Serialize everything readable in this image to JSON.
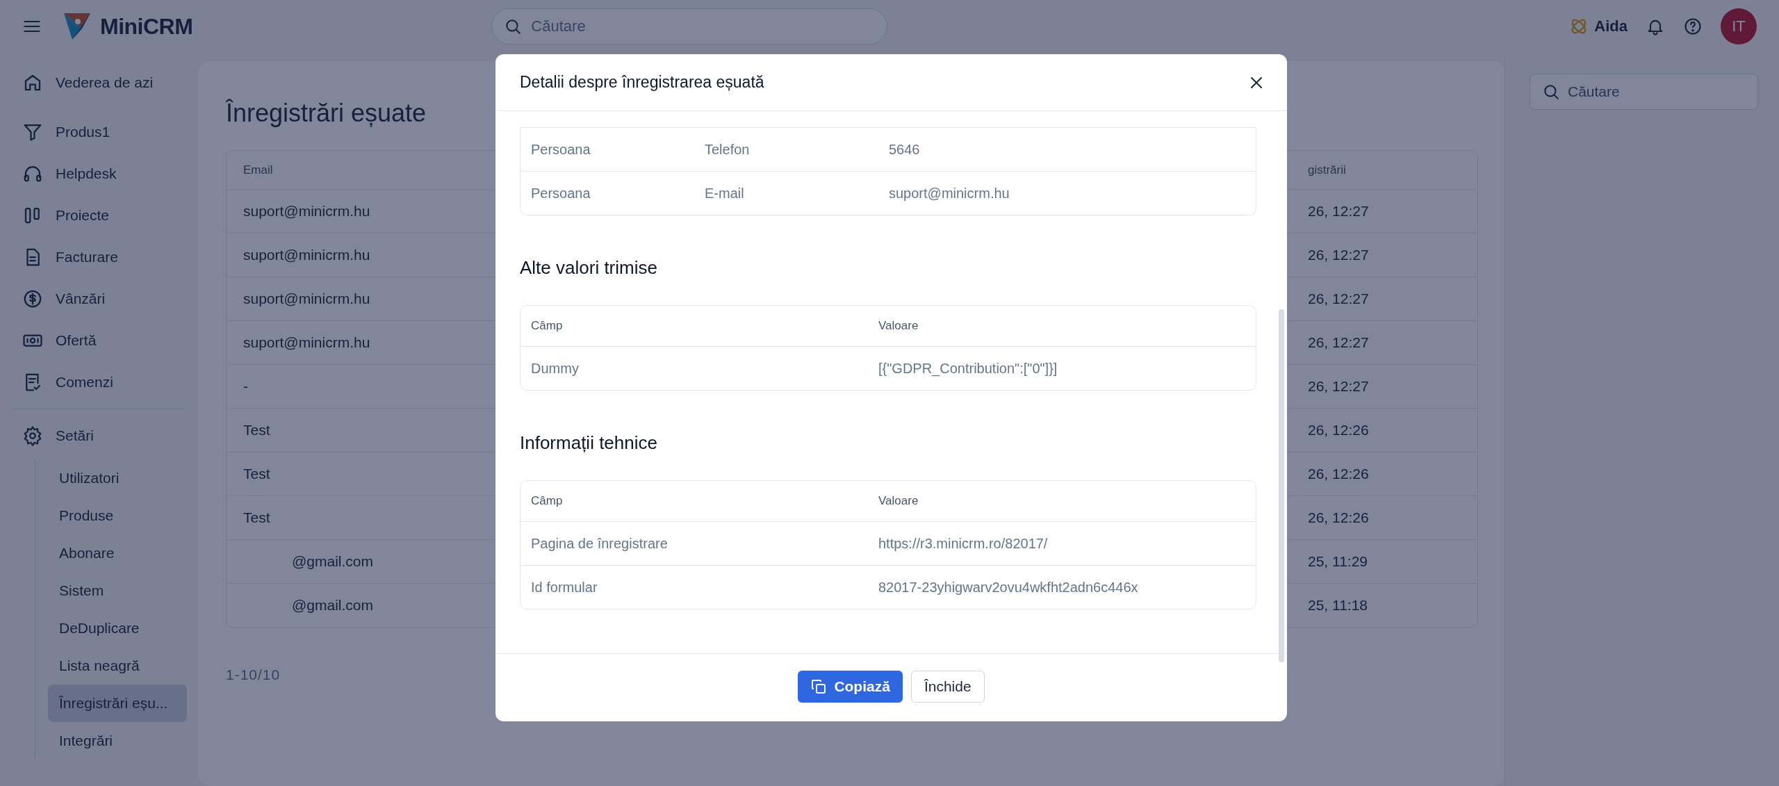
{
  "topbar": {
    "brand": "MiniCRM",
    "search": {
      "placeholder": "Căutare"
    },
    "assistant": "Aida",
    "avatar": "IT"
  },
  "sidebar": {
    "items": [
      {
        "label": "Vederea de azi"
      },
      {
        "label": "Produs1"
      },
      {
        "label": "Helpdesk"
      },
      {
        "label": "Proiecte"
      },
      {
        "label": "Facturare"
      },
      {
        "label": "Vânzări"
      },
      {
        "label": "Ofertă"
      },
      {
        "label": "Comenzi"
      }
    ],
    "settings": {
      "label": "Setări",
      "children": [
        {
          "label": "Utilizatori",
          "selected": false
        },
        {
          "label": "Produse",
          "selected": false
        },
        {
          "label": "Abonare",
          "selected": false
        },
        {
          "label": "Sistem",
          "selected": false
        },
        {
          "label": "DeDuplicare",
          "selected": false
        },
        {
          "label": "Lista neagră",
          "selected": false
        },
        {
          "label": "Înregistrări eșu...",
          "selected": true
        },
        {
          "label": "Integrări",
          "selected": false
        }
      ]
    }
  },
  "page": {
    "title": "Înregistrări eșuate",
    "search": {
      "placeholder": "Căutare"
    },
    "table": {
      "columns": [
        "Email",
        "gistrării"
      ],
      "rows": [
        {
          "email": "suport@minicrm.hu",
          "date": "26, 12:27"
        },
        {
          "email": "suport@minicrm.hu",
          "date": "26, 12:27"
        },
        {
          "email": "suport@minicrm.hu",
          "date": "26, 12:27"
        },
        {
          "email": "suport@minicrm.hu",
          "date": "26, 12:27"
        },
        {
          "email": "-",
          "date": "26, 12:27"
        },
        {
          "email": "Test",
          "date": "26, 12:26"
        },
        {
          "email": "Test",
          "date": "26, 12:26"
        },
        {
          "email": "Test",
          "date": "26, 12:26"
        },
        {
          "email": "@gmail.com",
          "date": "25, 11:29",
          "indented": true
        },
        {
          "email": "@gmail.com",
          "date": "25, 11:18",
          "indented": true
        }
      ]
    },
    "pagination": "1-10/10"
  },
  "modal": {
    "title": "Detalii despre înregistrarea eșuată",
    "sections": [
      {
        "rows": [
          [
            "Persoana",
            "Telefon",
            "5646"
          ],
          [
            "Persoana",
            "E-mail",
            "suport@minicrm.hu"
          ]
        ]
      },
      {
        "title": "Alte valori trimise",
        "columns": [
          "Câmp",
          "Valoare"
        ],
        "rows": [
          [
            "Dummy",
            "[{\"GDPR_Contribution\":[\"0\"]}]"
          ]
        ]
      },
      {
        "title": "Informații tehnice",
        "columns": [
          "Câmp",
          "Valoare"
        ],
        "rows": [
          [
            "Pagina de înregistrare",
            "https://r3.minicrm.ro/82017/"
          ],
          [
            "Id formular",
            "82017-23yhigwarv2ovu4wkfht2adn6c446x"
          ]
        ]
      }
    ],
    "buttons": [
      {
        "label": "Copiază",
        "kind": "primary"
      },
      {
        "label": "Închide",
        "kind": "secondary"
      }
    ]
  }
}
